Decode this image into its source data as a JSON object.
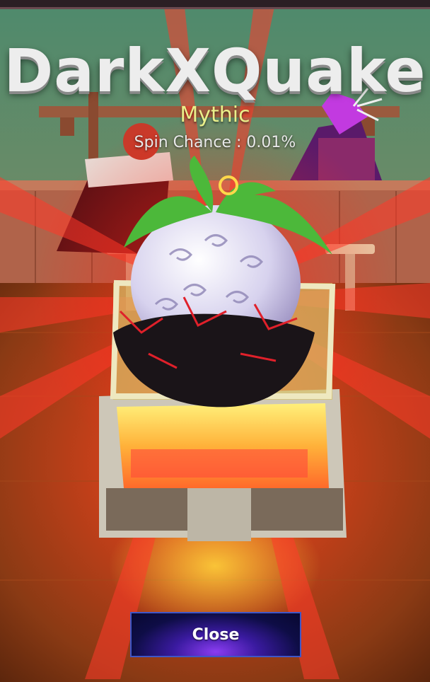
{
  "reward": {
    "name": "DarkXQuake",
    "rarity": "Mythic",
    "spin_chance": "Spin Chance : 0.01%"
  },
  "actions": {
    "close_label": "Close"
  },
  "colors": {
    "rarity": "#e9ef8a",
    "glow": "#ff2a1a",
    "button": "#1a1670"
  }
}
